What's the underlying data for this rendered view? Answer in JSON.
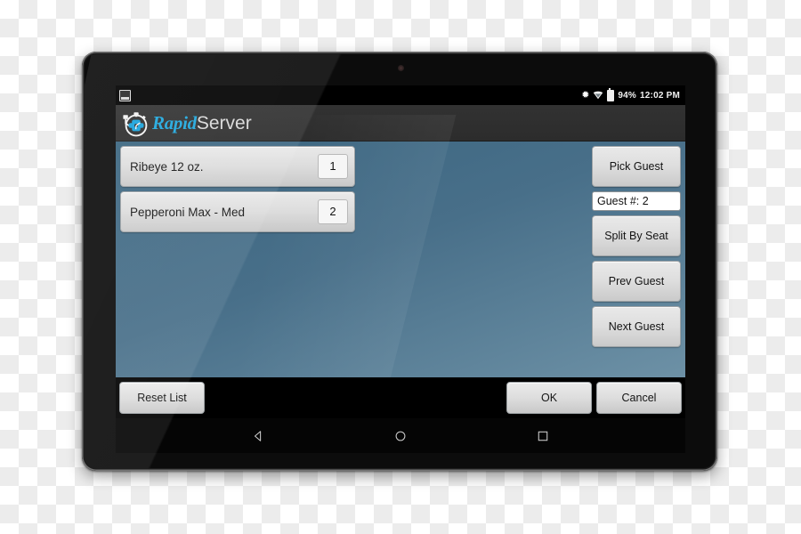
{
  "statusbar": {
    "notification_icon": "screenshot-image-icon",
    "bluetooth_icon": "bluetooth-icon",
    "wifi_icon": "wifi-icon",
    "battery_icon": "battery-icon",
    "battery_percent": "94%",
    "clock": "12:02 PM"
  },
  "appbar": {
    "logo_icon": "rapidserver-stopwatch-logo-icon",
    "brand_primary": "Rapid",
    "brand_secondary": "Server",
    "brand_color": "#1ea7dd"
  },
  "order": {
    "items": [
      {
        "name": "Ribeye 12 oz.",
        "qty": "1"
      },
      {
        "name": "Pepperoni Max - Med",
        "qty": "2"
      }
    ]
  },
  "guest_panel": {
    "pick_guest": "Pick Guest",
    "guest_number_value": "Guest #: 2",
    "split_by_seat": "Split By Seat",
    "prev_guest": "Prev Guest",
    "next_guest": "Next Guest"
  },
  "actions": {
    "reset_list": "Reset List",
    "ok": "OK",
    "cancel": "Cancel"
  },
  "navbar": {
    "back_icon": "back-triangle-icon",
    "home_icon": "home-circle-icon",
    "recents_icon": "recents-square-icon"
  },
  "theme": {
    "content_bg_top": "#3a6580",
    "content_bg_bottom": "#6d91a6",
    "appbar_bg": "#2e2e2e",
    "button_face": "#dedede"
  }
}
